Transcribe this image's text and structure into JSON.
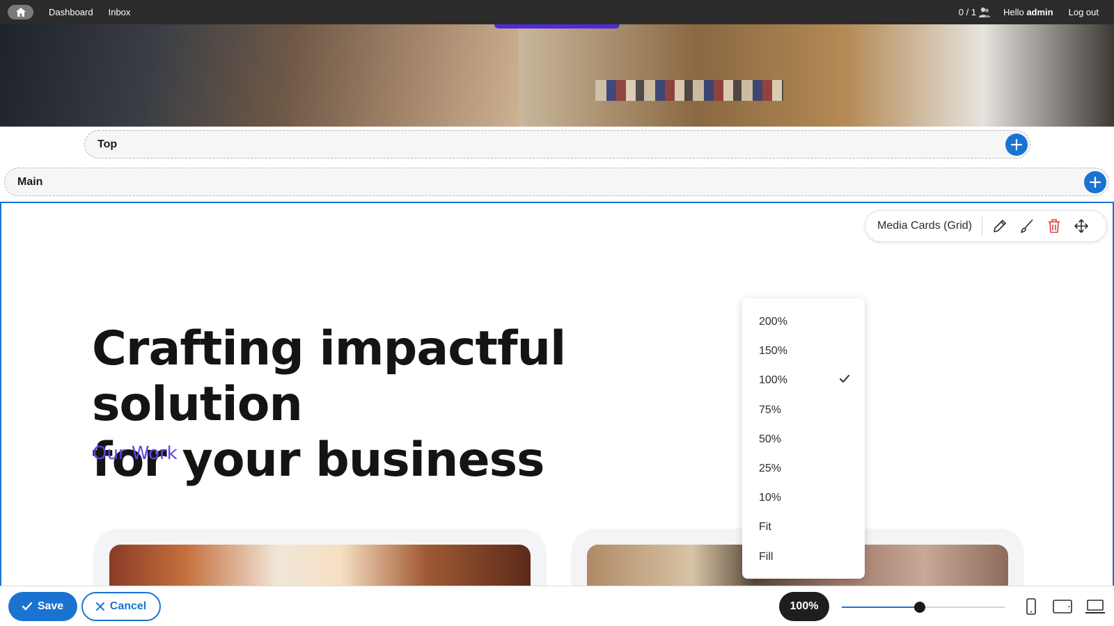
{
  "topbar": {
    "home_icon": "home-icon",
    "links": [
      "Dashboard",
      "Inbox"
    ],
    "counter": "0 / 1",
    "hello_prefix": "Hello",
    "username": "admin",
    "logout": "Log out"
  },
  "regions": {
    "top_label": "Top",
    "main_label": "Main"
  },
  "block": {
    "toolbar_name": "Media Cards (Grid)",
    "headline_line1": "Crafting impactful solution",
    "headline_line2": "for your business",
    "subhead": "Our Work"
  },
  "zoom_menu": {
    "options": [
      "200%",
      "150%",
      "100%",
      "75%",
      "50%",
      "25%",
      "10%",
      "Fit",
      "Fill"
    ],
    "selected": "100%"
  },
  "bottombar": {
    "save_label": "Save",
    "cancel_label": "Cancel",
    "zoom_value": "100%",
    "zoom_slider_fraction": 0.48
  },
  "colors": {
    "accent": "#1a73d1",
    "topbar_bg": "#2b2b2b",
    "subhead": "#5b46e6",
    "delete": "#e03a3a"
  }
}
